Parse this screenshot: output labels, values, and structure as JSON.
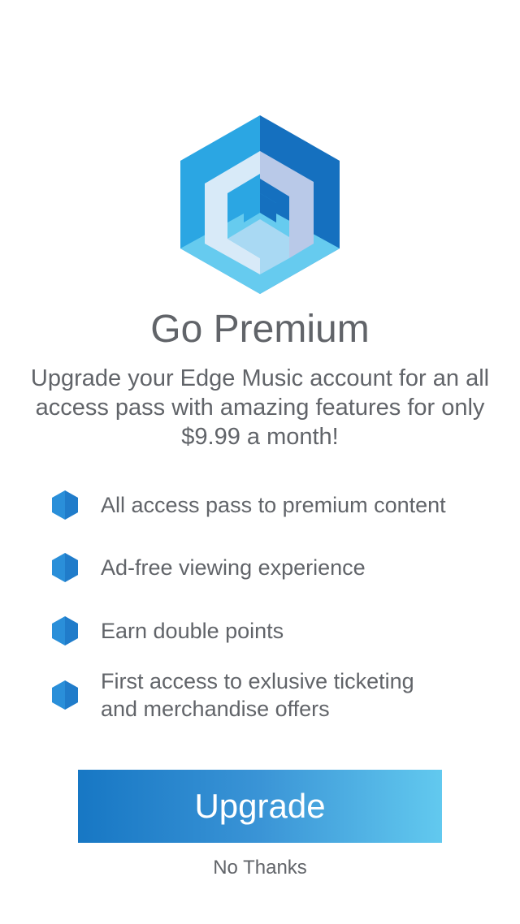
{
  "header": {
    "logo_icon": "edge-music-hexagon-logo-icon",
    "title": "Go Premium",
    "subtitle": "Upgrade your Edge Music account for an all access pass with amazing features for only $9.99 a month!"
  },
  "features": [
    {
      "icon": "hexagon-bullet-icon",
      "text": "All access pass to premium content"
    },
    {
      "icon": "hexagon-bullet-icon",
      "text": "Ad-free viewing experience"
    },
    {
      "icon": "hexagon-bullet-icon",
      "text": "Earn double points"
    },
    {
      "icon": "hexagon-bullet-icon",
      "text": "First access to exlusive ticketing\nand merchandise offers"
    }
  ],
  "actions": {
    "upgrade_label": "Upgrade",
    "no_thanks_label": "No Thanks"
  },
  "colors": {
    "text": "#616469",
    "accent_dark": "#1777c4",
    "accent_light": "#62c9ef",
    "logo_light": "#5cc8f0",
    "logo_mid": "#2ba6e3",
    "logo_dark": "#1570bf"
  }
}
